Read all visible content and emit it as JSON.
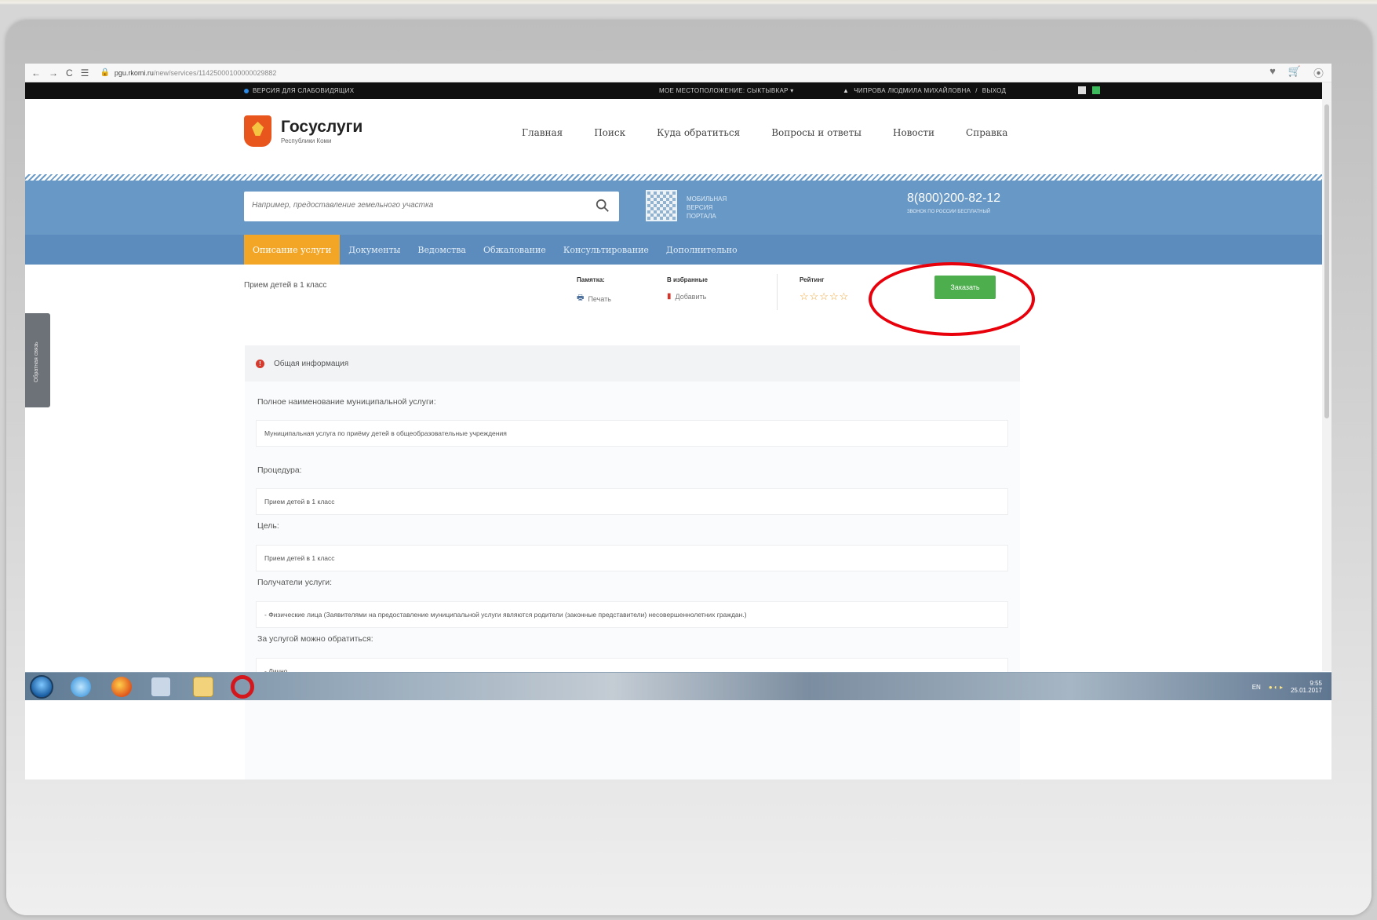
{
  "browser": {
    "nav_glyphs": [
      "←",
      "→",
      "C",
      "☰"
    ],
    "url_host": "pgu.rkomi.ru",
    "url_path": "/new/services/11425000100000029882",
    "right_glyphs": [
      "♥",
      "🛒",
      "⦿"
    ]
  },
  "topstrip": {
    "vision_version": "ВЕРСИЯ ДЛЯ СЛАБОВИДЯЩИХ",
    "location": "МОЕ МЕСТОПОЛОЖЕНИЕ: СЫКТЫВКАР ▾",
    "user_name": "ЧИПРОВА ЛЮДМИЛА МИХАЙЛОВНА",
    "separator": "/",
    "logout": "ВЫХОД"
  },
  "header": {
    "logo_title": "Госуслуги",
    "logo_subtitle": "Республики Коми",
    "nav": [
      "Главная",
      "Поиск",
      "Куда обратиться",
      "Вопросы и ответы",
      "Новости",
      "Справка"
    ]
  },
  "search": {
    "placeholder": "Например, предоставление земельного участка",
    "mobile_line1": "Мобильная",
    "mobile_line2": "версия",
    "mobile_line3": "портала",
    "phone": "8(800)200-82-12",
    "phone_note": "звонок по россии бесплатный"
  },
  "tabs": {
    "items": [
      "Описание услуги",
      "Документы",
      "Ведомства",
      "Обжалование",
      "Консультирование",
      "Дополнительно"
    ],
    "active_index": 0
  },
  "service": {
    "title": "Прием детей в 1 класс",
    "memo_label": "Памятка:",
    "memo_action": "Печать",
    "favorites_label": "В избранные",
    "favorites_action": "Добавить",
    "rating_label": "Рейтинг",
    "rating_stars": "☆☆☆☆☆",
    "order_button": "Заказать"
  },
  "info": {
    "panel_title": "Общая информация",
    "fields": [
      {
        "label": "Полное наименование муниципальной услуги:",
        "value": "Муниципальная услуга по приёму детей в общеобразовательные учреждения"
      },
      {
        "label": "Процедура:",
        "value": "Прием детей в 1 класс"
      },
      {
        "label": "Цель:",
        "value": "Прием детей в 1 класс"
      },
      {
        "label": "Получатели услуги:",
        "value": "- Физические лица (Заявителями на предоставление муниципальной услуги являются родители (законные представители) несовершеннолетних граждан.)"
      },
      {
        "label": "За услугой можно обратиться:",
        "value": "- Лично"
      }
    ]
  },
  "feedback": {
    "label": "Обратная связь"
  },
  "taskbar": {
    "lang": "EN",
    "time": "9:55",
    "date": "25.01.2017"
  },
  "colors": {
    "band_blue": "#6899c6",
    "tab_active": "#f3a626",
    "order_green": "#4cae4c",
    "annotation_red": "#e8000b"
  }
}
